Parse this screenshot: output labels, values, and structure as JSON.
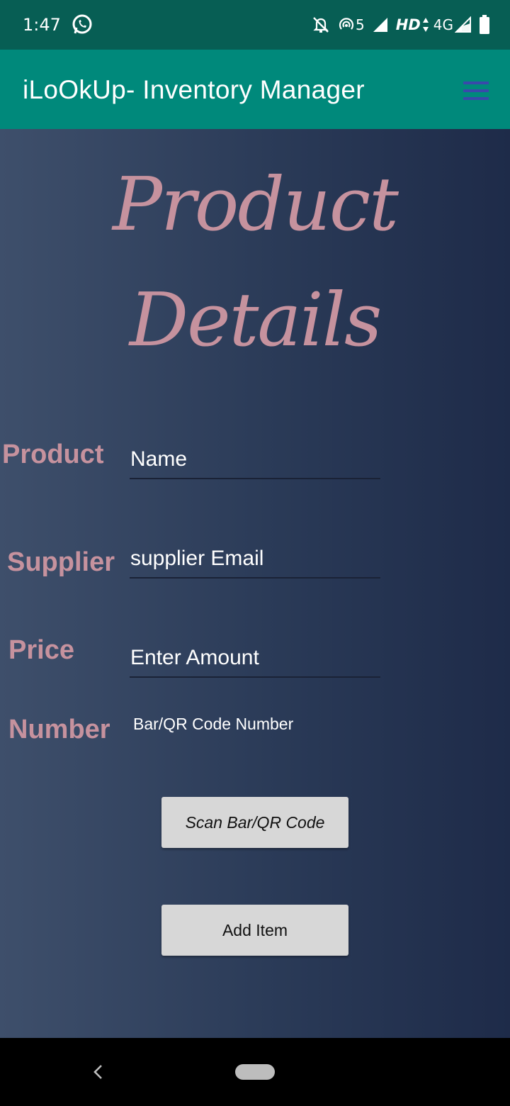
{
  "status_bar": {
    "time": "1:47",
    "signal_label": "5",
    "hd_label": "HD",
    "network_label": "4G",
    "icons": [
      "whatsapp-icon",
      "bell-off-icon",
      "hotspot-icon",
      "signal-icon",
      "data-arrows-icon",
      "signal-icon",
      "battery-icon"
    ]
  },
  "app_bar": {
    "title": "iLoOkUp- Inventory Manager",
    "menu_icon": "hamburger-menu-icon"
  },
  "page": {
    "title_line1": "Product",
    "title_line2": "Details"
  },
  "form": {
    "product_label": "Product",
    "product_placeholder": "Name",
    "supplier_label": "Supplier",
    "supplier_placeholder": "supplier Email",
    "price_label": "Price",
    "price_placeholder": "Enter Amount",
    "number_label": "Number",
    "number_value": "Bar/QR Code Number"
  },
  "buttons": {
    "scan_label": "Scan Bar/QR Code",
    "add_label": "Add Item"
  },
  "navigation": {
    "icons": [
      "back-icon",
      "home-pill-icon"
    ]
  },
  "colors": {
    "status_bar": "#075e54",
    "app_bar": "#00897b",
    "accent_label": "#c6929e",
    "menu_icon": "#3949ab",
    "background_start": "#3e4f6b",
    "background_end": "#1e2b49",
    "button": "#d7d7d7"
  }
}
